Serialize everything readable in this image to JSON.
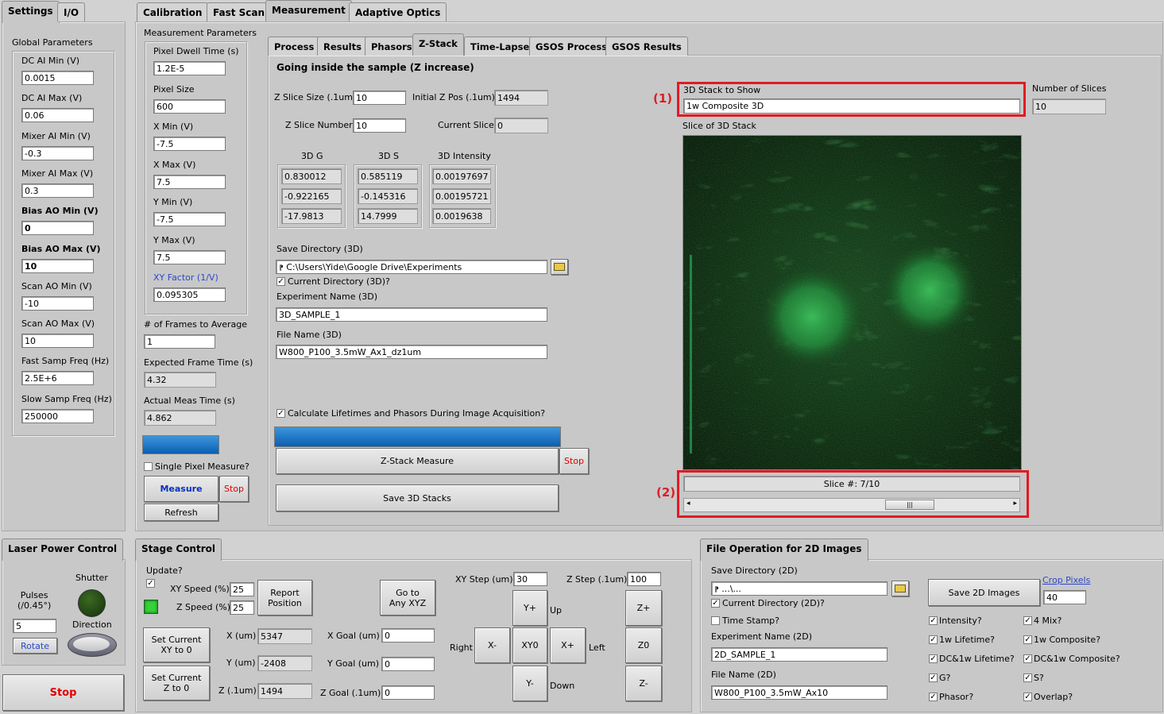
{
  "left_tabs": [
    "Settings",
    "I/O"
  ],
  "main_tabs": [
    "Calibration",
    "Fast Scan",
    "Measurement",
    "Adaptive Optics"
  ],
  "sub_tabs": [
    "Process",
    "Results",
    "Phasors",
    "Z-Stack",
    "Time-Lapse",
    "GSOS Process",
    "GSOS Results"
  ],
  "global": {
    "title": "Global Parameters",
    "params": [
      {
        "label": "DC AI Min (V)",
        "value": "0.0015"
      },
      {
        "label": "DC AI Max (V)",
        "value": "0.06"
      },
      {
        "label": "Mixer AI Min (V)",
        "value": "-0.3"
      },
      {
        "label": "Mixer AI Max (V)",
        "value": "0.3"
      },
      {
        "label": "Bias AO Min (V)",
        "value": "0"
      },
      {
        "label": "Bias AO Max (V)",
        "value": "10"
      },
      {
        "label": "Scan AO Min (V)",
        "value": "-10"
      },
      {
        "label": "Scan AO Max (V)",
        "value": "10"
      },
      {
        "label": "Fast Samp Freq (Hz)",
        "value": "2.5E+6"
      },
      {
        "label": "Slow Samp Freq (Hz)",
        "value": "250000"
      }
    ]
  },
  "meas_params": {
    "title": "Measurement Parameters",
    "params": [
      {
        "label": "Pixel Dwell Time (s)",
        "value": "1.2E-5"
      },
      {
        "label": "Pixel Size",
        "value": "600"
      },
      {
        "label": "X Min (V)",
        "value": "-7.5"
      },
      {
        "label": "X Max (V)",
        "value": "7.5"
      },
      {
        "label": "Y Min (V)",
        "value": "-7.5"
      },
      {
        "label": "Y Max (V)",
        "value": "7.5"
      },
      {
        "label": "XY Factor (1/V)",
        "value": "0.095305"
      }
    ],
    "frames_label": "# of Frames to Average",
    "frames_value": "1",
    "expected_label": "Expected Frame Time (s)",
    "expected_value": "4.32",
    "actual_label": "Actual Meas Time (s)",
    "actual_value": "4.862",
    "progress": 1.0,
    "single_pixel": "Single Pixel Measure?",
    "measure": "Measure",
    "stop": "Stop",
    "refresh": "Refresh"
  },
  "zstack": {
    "heading": "Going inside the sample (Z increase)",
    "slice_size_label": "Z Slice Size (.1um)",
    "slice_size": "10",
    "init_z_label": "Initial Z Pos (.1um)",
    "init_z": "1494",
    "slice_number_label": "Z Slice Number",
    "slice_number": "10",
    "current_slice_label": "Current Slice",
    "current_slice": "0",
    "g_label": "3D G",
    "g": [
      "0.830012",
      "-0.922165",
      "-17.9813"
    ],
    "s_label": "3D S",
    "s": [
      "0.585119",
      "-0.145316",
      "14.7999"
    ],
    "i_label": "3D Intensity",
    "i": [
      "0.00197697",
      "0.00195721",
      "0.0019638"
    ],
    "save_dir_label": "Save Directory (3D)",
    "save_dir": "C:\\Users\\Yide\\Google Drive\\Experiments",
    "cur_dir_label": "Current Directory (3D)?",
    "exp_name_label": "Experiment Name (3D)",
    "exp_name": "3D_SAMPLE_1",
    "file_name_label": "File Name (3D)",
    "file_name": "W800_P100_3.5mW_Ax1_dz1um",
    "calc_label": "Calculate Lifetimes and Phasors During Image Acquisition?",
    "progress": 1.0,
    "measure": "Z-Stack Measure",
    "stop": "Stop",
    "save": "Save 3D Stacks",
    "show_label": "3D Stack to Show",
    "show_value": "1w Composite 3D",
    "num_slices_label": "Number of Slices",
    "num_slices": "10",
    "slice_view_label": "Slice of 3D Stack",
    "slice_number_text": "Slice #: 7/10",
    "marker1": "(1)",
    "marker2": "(2)"
  },
  "laser": {
    "title": "Laser Power Control",
    "shutter": "Shutter",
    "pulses": "Pulses\n(/0.45°)",
    "pulses_value": "5",
    "rotate": "Rotate",
    "direction": "Direction",
    "stop": "Stop"
  },
  "stage": {
    "title": "Stage Control",
    "update": "Update?",
    "xy_speed_label": "XY Speed (%)",
    "xy_speed": "25",
    "z_speed_label": "Z Speed (%)",
    "z_speed": "25",
    "report": "Report\nPosition",
    "goto": "Go to\nAny XYZ",
    "set_xy": "Set Current\nXY to 0",
    "set_z": "Set Current\nZ to 0",
    "x_label": "X (um)",
    "x": "5347",
    "y_label": "Y (um)",
    "y": "-2408",
    "z_label": "Z (.1um)",
    "z": "1494",
    "xg_label": "X Goal (um)",
    "xg": "0",
    "yg_label": "Y Goal (um)",
    "yg": "0",
    "zg_label": "Z Goal (.1um)",
    "zg": "0",
    "xy_step_label": "XY Step (um)",
    "xy_step": "30",
    "z_step_label": "Z Step (.1um)",
    "z_step": "100",
    "yplus": "Y+",
    "yminus": "Y-",
    "xminus": "X-",
    "xplus": "X+",
    "xy0": "XY0",
    "zplus": "Z+",
    "z0": "Z0",
    "zminus": "Z-",
    "up": "Up",
    "down": "Down",
    "right": "Right",
    "left": "Left"
  },
  "fileop": {
    "title": "File Operation for 2D Images",
    "save_dir_label": "Save Directory (2D)",
    "save_dir": "...\\...",
    "cur_dir": "Current Directory (2D)?",
    "time_stamp": "Time Stamp?",
    "exp_label": "Experiment Name (2D)",
    "exp": "2D_SAMPLE_1",
    "file_label": "File Name (2D)",
    "file": "W800_P100_3.5mW_Ax10",
    "save2d": "Save 2D Images",
    "crop_label": "Crop Pixels",
    "crop": "40",
    "opts": [
      "Intensity?",
      "4 Mix?",
      "1w Lifetime?",
      "1w Composite?",
      "DC&1w Lifetime?",
      "DC&1w Composite?",
      "G?",
      "S?",
      "Phasor?",
      "Overlap?"
    ]
  },
  "colors": {
    "accent_red": "#e01b24",
    "progress_blue": "#0a6fc2",
    "link_blue": "#2b48c8"
  }
}
